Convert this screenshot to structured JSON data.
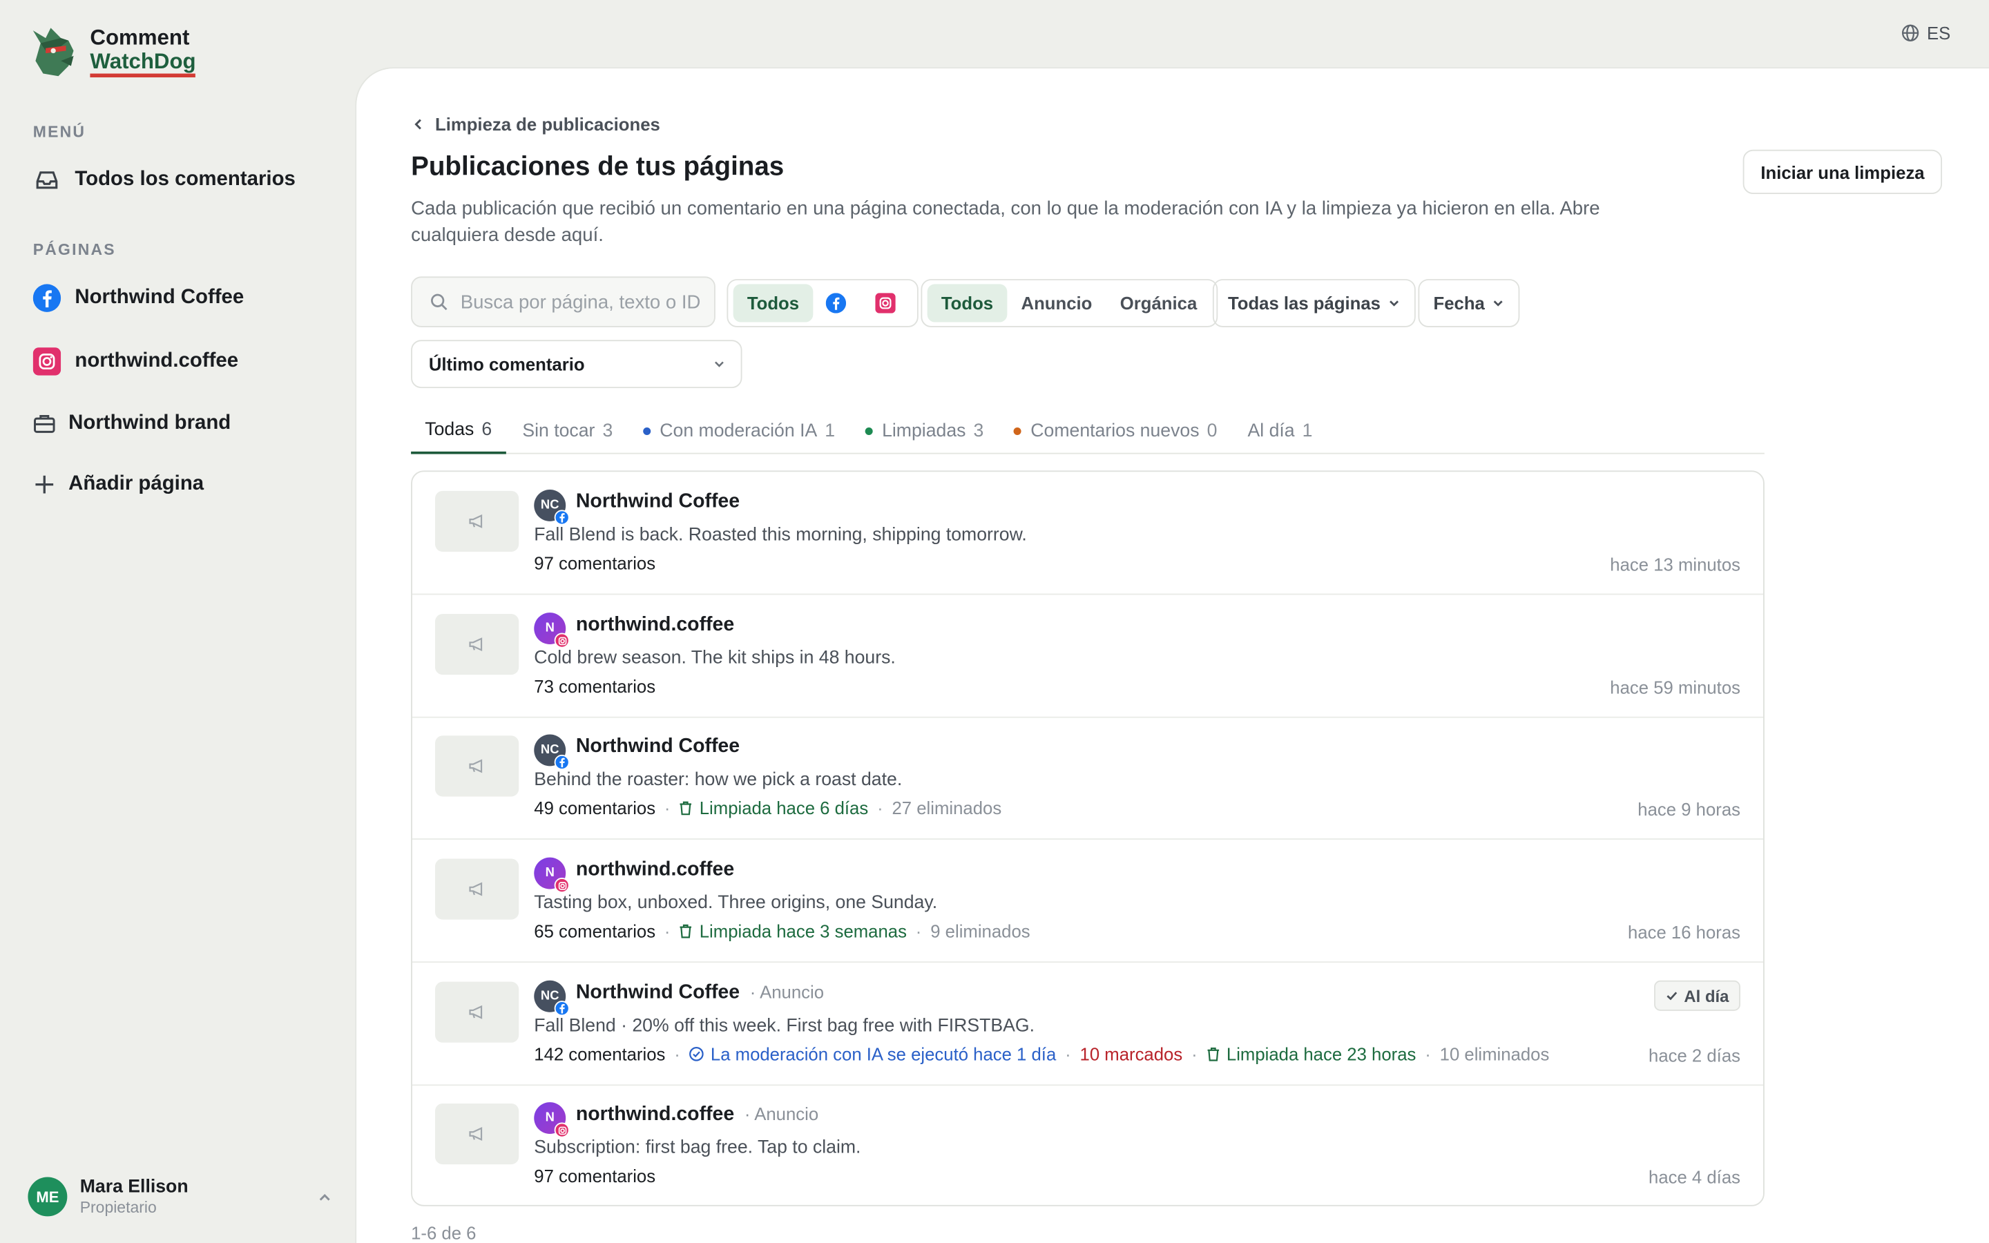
{
  "app": {
    "name_line1": "Comment",
    "name_line2": "WatchDog"
  },
  "lang": {
    "code": "ES"
  },
  "sidebar": {
    "menu_label": "MENÚ",
    "all_comments": "Todos los comentarios",
    "pages_label": "PÁGINAS",
    "pages": [
      {
        "label": "Northwind Coffee",
        "icon": "facebook-icon"
      },
      {
        "label": "northwind.coffee",
        "icon": "instagram-icon"
      },
      {
        "label": "Northwind brand",
        "icon": "briefcase-icon"
      }
    ],
    "add_page": "Añadir página"
  },
  "user": {
    "initials": "ME",
    "name": "Mara Ellison",
    "role": "Propietario"
  },
  "breadcrumb": {
    "label": "Limpieza de publicaciones"
  },
  "page": {
    "title": "Publicaciones de tus páginas",
    "description": "Cada publicación que recibió un comentario en una página conectada, con lo que la moderación con IA y la limpieza ya hicieron en ella. Abre cualquiera desde aquí.",
    "start_button": "Iniciar una limpieza"
  },
  "filters": {
    "search_placeholder": "Busca por página, texto o ID",
    "platform": {
      "all": "Todos"
    },
    "type": {
      "all": "Todos",
      "ad": "Anuncio",
      "organic": "Orgánica"
    },
    "pages": "Todas las páginas",
    "date": "Fecha",
    "sort": "Último comentario"
  },
  "tabs": [
    {
      "label": "Todas",
      "count": "6"
    },
    {
      "label": "Sin tocar",
      "count": "3"
    },
    {
      "label": "Con moderación IA",
      "count": "1",
      "dot": "#2a60c8"
    },
    {
      "label": "Limpiadas",
      "count": "3",
      "dot": "#1d8a52"
    },
    {
      "label": "Comentarios nuevos",
      "count": "0",
      "dot": "#d0651a"
    },
    {
      "label": "Al día",
      "count": "1"
    }
  ],
  "posts": [
    {
      "initials": "NC",
      "page": "Northwind Coffee",
      "text": "Fall Blend is back. Roasted this morning, shipping tomorrow.",
      "comments": "97 comentarios",
      "time": "hace 13 minutos"
    },
    {
      "initials": "N",
      "page": "northwind.coffee",
      "text": "Cold brew season. The kit ships in 48 hours.",
      "comments": "73 comentarios",
      "time": "hace 59 minutos"
    },
    {
      "initials": "NC",
      "page": "Northwind Coffee",
      "text": "Behind the roaster: how we pick a roast date.",
      "comments": "49 comentarios",
      "cleaned": "Limpiada hace 6 días",
      "removed": "27 eliminados",
      "time": "hace 9 horas"
    },
    {
      "initials": "N",
      "page": "northwind.coffee",
      "text": "Tasting box, unboxed. Three origins, one Sunday.",
      "comments": "65 comentarios",
      "cleaned": "Limpiada hace 3 semanas",
      "removed": "9 eliminados",
      "time": "hace 16 horas"
    },
    {
      "initials": "NC",
      "page": "Northwind Coffee",
      "ad": "· Anuncio",
      "text": "Fall Blend · 20% off this week. First bag free with FIRSTBAG.",
      "comments": "142 comentarios",
      "ai": "La moderación con IA se ejecutó hace 1 día",
      "flagged": "10 marcados",
      "cleaned": "Limpiada hace 23 horas",
      "removed": "10 eliminados",
      "time": "hace 2 días",
      "badge": "Al día"
    },
    {
      "initials": "N",
      "page": "northwind.coffee",
      "ad": "· Anuncio",
      "text": "Subscription: first bag free. Tap to claim.",
      "comments": "97 comentarios",
      "time": "hace 4 días"
    }
  ],
  "pager": {
    "label": "1-6 de 6"
  },
  "colors": {
    "accent": "#1d5a3b",
    "sidebar_bg": "#eeefeb",
    "facebook": "#1877f2",
    "instagram": "#e1306c",
    "danger": "#b8232a",
    "ai_blue": "#2a60c8"
  }
}
